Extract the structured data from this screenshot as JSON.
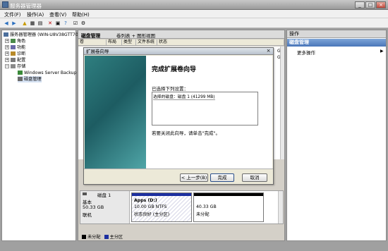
{
  "window": {
    "title": "服务器管理器",
    "min": "_",
    "max": "□",
    "close": "×"
  },
  "menu": [
    "文件(F)",
    "操作(A)",
    "查看(V)",
    "帮助(H)"
  ],
  "toolbar": {
    "icons": [
      "back-icon",
      "forward-icon",
      "up-icon",
      "show-tree-icon",
      "properties-icon",
      "delete-icon",
      "help-icon",
      "export-icon",
      "check-icon",
      "settings-icon"
    ]
  },
  "tree": {
    "root": "服务器管理器 (WIN-U8V38GTT70",
    "items": [
      "角色",
      "功能",
      "诊断",
      "配置",
      "存储",
      "Windows Server Backup",
      "磁盘管理"
    ]
  },
  "center": {
    "title": "磁盘管理",
    "view": "卷列表 + 图形视图",
    "columns": [
      "卷",
      "布局",
      "类型",
      "文件系统",
      "状态"
    ],
    "right_sizes": [
      "GB",
      "GB"
    ]
  },
  "actions": {
    "header": "操作",
    "section": "磁盘管理",
    "more": "更多操作",
    "more_arrow": "▶"
  },
  "wizard": {
    "title": "扩展卷向导",
    "close": "×",
    "heading": "完成扩展卷向导",
    "selected_label": "已选择下列设置：",
    "settings_line": "选择的磁盘：磁盘 1 (41299 MB)",
    "close_hint": "若要关闭此向导，请单击\"完成\"。",
    "back": "< 上一步(B)",
    "finish": "完成",
    "cancel": "取消"
  },
  "disk": {
    "name": "磁盘 1",
    "type": "基本",
    "size": "50.33 GB",
    "status": "联机",
    "partitions": [
      {
        "label": "Apps (D:)",
        "size": "10.00 GB NTFS",
        "status": "状态良好 (主分区)",
        "color": "#1c2fa0"
      },
      {
        "label": "",
        "size": "40.33 GB",
        "status": "未分配",
        "color": "#000000"
      }
    ]
  },
  "legend": [
    {
      "label": "未分配",
      "color": "#000000"
    },
    {
      "label": "主分区",
      "color": "#1c2fa0"
    }
  ]
}
